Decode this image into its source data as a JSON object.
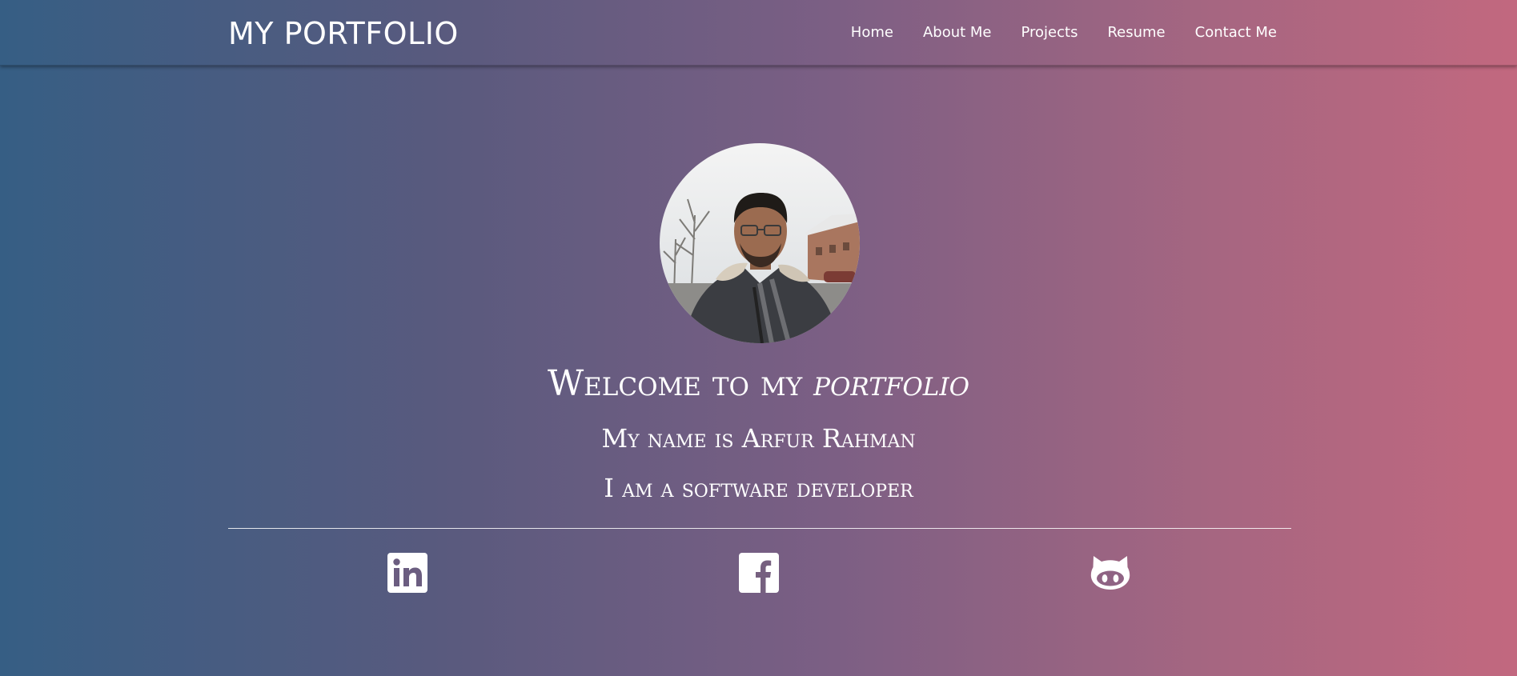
{
  "navbar": {
    "brand": "MY PORTFOLIO",
    "links": [
      "Home",
      "About Me",
      "Projects",
      "Resume",
      "Contact Me"
    ]
  },
  "hero": {
    "welcome_prefix": "Welcome to my ",
    "welcome_emphasis": "portfolio",
    "name_line": "My name is Arfur Rahman",
    "role_line": "I am a software developer"
  },
  "social": {
    "icons": [
      "linkedin-icon",
      "facebook-icon",
      "github-icon"
    ]
  },
  "colors": {
    "gradient_left": "#365e84",
    "gradient_right": "#c2687f",
    "text": "#ffffff"
  }
}
